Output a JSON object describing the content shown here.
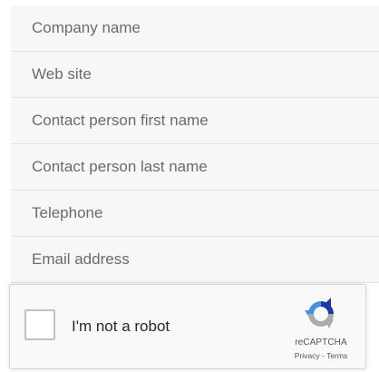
{
  "form": {
    "fields": [
      {
        "placeholder": "Company name",
        "value": ""
      },
      {
        "placeholder": "Web site",
        "value": ""
      },
      {
        "placeholder": "Contact person first name",
        "value": ""
      },
      {
        "placeholder": "Contact person last name",
        "value": ""
      },
      {
        "placeholder": "Telephone",
        "value": ""
      },
      {
        "placeholder": "Email address",
        "value": ""
      }
    ]
  },
  "recaptcha": {
    "label": "I'm not a robot",
    "brand": "reCAPTCHA",
    "privacy": "Privacy",
    "separator": " - ",
    "terms": "Terms",
    "checked": false,
    "logo_icon": "recaptcha-logo-icon",
    "colors": {
      "logo_blue": "#4a90e2",
      "logo_dark_blue": "#1c3aa9",
      "logo_gray": "#ababab"
    }
  }
}
